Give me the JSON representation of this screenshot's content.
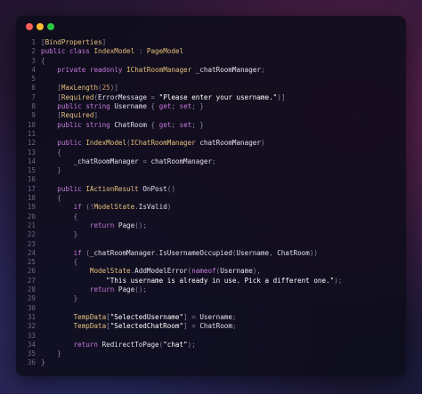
{
  "window": {
    "controls": {
      "close_color": "#ff5f57",
      "minimize_color": "#febc2e",
      "maximize_color": "#28c840"
    }
  },
  "code": {
    "lines": [
      {
        "n": "1",
        "t": "[BindProperties]"
      },
      {
        "n": "2",
        "t": "public class IndexModel : PageModel"
      },
      {
        "n": "3",
        "t": "{"
      },
      {
        "n": "4",
        "t": "    private readonly IChatRoomManager _chatRoomManager;"
      },
      {
        "n": "5",
        "t": ""
      },
      {
        "n": "6",
        "t": "    [MaxLength(25)]"
      },
      {
        "n": "7",
        "t": "    [Required(ErrorMessage = \"Please enter your username.\")]"
      },
      {
        "n": "8",
        "t": "    public string Username { get; set; }"
      },
      {
        "n": "9",
        "t": "    [Required]"
      },
      {
        "n": "10",
        "t": "    public string ChatRoom { get; set; }"
      },
      {
        "n": "11",
        "t": ""
      },
      {
        "n": "12",
        "t": "    public IndexModel(IChatRoomManager chatRoomManager)"
      },
      {
        "n": "13",
        "t": "    {"
      },
      {
        "n": "14",
        "t": "        _chatRoomManager = chatRoomManager;"
      },
      {
        "n": "15",
        "t": "    }"
      },
      {
        "n": "16",
        "t": ""
      },
      {
        "n": "17",
        "t": "    public IActionResult OnPost()"
      },
      {
        "n": "18",
        "t": "    {"
      },
      {
        "n": "19",
        "t": "        if (!ModelState.IsValid)"
      },
      {
        "n": "20",
        "t": "        {"
      },
      {
        "n": "21",
        "t": "            return Page();"
      },
      {
        "n": "22",
        "t": "        }"
      },
      {
        "n": "23",
        "t": ""
      },
      {
        "n": "24",
        "t": "        if (_chatRoomManager.IsUsernameOccupied(Username, ChatRoom))"
      },
      {
        "n": "25",
        "t": "        {"
      },
      {
        "n": "26",
        "t": "            ModelState.AddModelError(nameof(Username),"
      },
      {
        "n": "27",
        "t": "                \"This username is already in use. Pick a different one.\");"
      },
      {
        "n": "28",
        "t": "            return Page();"
      },
      {
        "n": "29",
        "t": "        }"
      },
      {
        "n": "30",
        "t": ""
      },
      {
        "n": "31",
        "t": "        TempData[\"SelectedUsername\"] = Username;"
      },
      {
        "n": "32",
        "t": "        TempData[\"SelectedChatRoom\"] = ChatRoom;"
      },
      {
        "n": "33",
        "t": ""
      },
      {
        "n": "34",
        "t": "        return RedirectToPage(\"chat\");"
      },
      {
        "n": "35",
        "t": "    }"
      },
      {
        "n": "36",
        "t": "}"
      }
    ]
  }
}
